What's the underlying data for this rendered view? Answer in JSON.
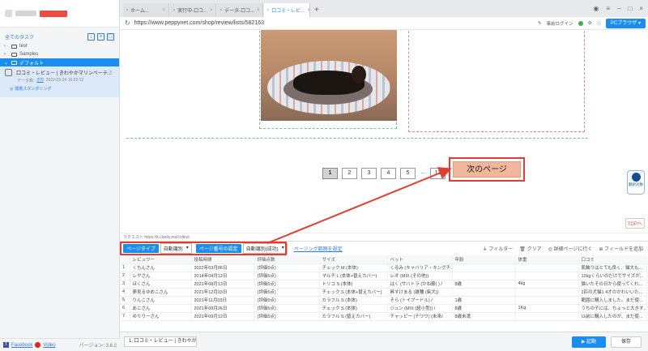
{
  "sidebar": {
    "all_tasks": "全てのタスク",
    "tree": [
      {
        "label": "test",
        "caret": "›"
      },
      {
        "label": "Samples",
        "caret": "›"
      },
      {
        "label": "デフォルト",
        "caret": "⌄"
      }
    ],
    "task": {
      "title": "口コミ・レビュー | きわやかマリンベーテ...",
      "meta_label": "データ数:",
      "meta_count": "270",
      "meta_time": "2022-03-24 16:52:12",
      "status": "閲覧スタンダリング",
      "close": "×"
    },
    "footer": {
      "facebook": "Facebook",
      "video": "Video",
      "version": "バージョン: 3.6.2"
    }
  },
  "tabs": [
    {
      "label": "ホーム..."
    },
    {
      "label": "実行中-口コ..."
    },
    {
      "label": "データ-口コ..."
    },
    {
      "label": "口コミ・レビ..."
    }
  ],
  "url": "https://www.peppynet.com/shop/review/lists/582163",
  "urlbar": {
    "login": "事前ログイン",
    "pc": "PCブラウザ"
  },
  "pager": {
    "pages": [
      "1",
      "2",
      "3",
      "4",
      "5",
      "12"
    ],
    "current": "1",
    "ellipsis": "...",
    "next": "次のページ"
  },
  "floaty": {
    "label": "翻訳対象"
  },
  "top_btn": "TOPへ",
  "request": "リクエスト:https://k.clarity.ms/collect",
  "data_toolbar": {
    "page_type": "ページタイプ",
    "page_type_value": "自動識別",
    "page_num": "ページ番号の認定",
    "page_num_value": "自動識別(成功)",
    "range": "ページング範囲を設定",
    "filter": "フィルター",
    "clear": "クリア",
    "detail": "詳細ページに行く",
    "add_field": "フィールドを追加"
  },
  "table": {
    "headers": [
      "",
      "レビュワー",
      "投稿時間",
      "評価点数",
      "サイズ",
      "ペット",
      "年齢",
      "体重",
      "口コミ"
    ],
    "rows": [
      [
        "1",
        "くちんさん",
        "2022年03月06日",
        "(評価5点)",
        "チェック M (本体)",
        "くるみ (キャバリア・キングチ...",
        "",
        "",
        "肌触りはとても良く、猫大も..."
      ],
      [
        "2",
        "レヤさん",
        "2014年04月12日",
        "(評価5点)",
        "マルチ L (本体+替えカバー)",
        "レオ (MIX (その他))",
        "",
        "",
        "12kgくらいのだけでサイズが..."
      ],
      [
        "3",
        "ほくさん",
        "2021年08月13日",
        "(評価5点)",
        "トリコ S (本体)",
        "はく (サバトラ (かね藤) )  /",
        "8歳",
        "4kg",
        "猫いたその日から使ってくれ..."
      ],
      [
        "4",
        "夢見るゆめこさん",
        "2021年12月03日",
        "(評価5点)",
        "チェック S (本体+替えカバー)",
        "昇すけまる (雑種 (柴犬))",
        "",
        "",
        "2匹の犬猫1 4才のかわいいた..."
      ],
      [
        "5",
        "りんこさん",
        "2021年11月03日",
        "(評価5点)",
        "カラフル S (本体)",
        "そら (トイプードル)  /",
        "1歳",
        "",
        "範囲に購入しました。まだ使..."
      ],
      [
        "6",
        "あこさん",
        "2021年09月26日",
        "(評価5点)",
        "チェック S (本体)",
        "ジュン (MIX (超小型)) /",
        "8歳",
        "1Kg",
        "うちの子には、ちょっと大きす..."
      ],
      [
        "7",
        "ゆりりーさん",
        "2021年09月12日",
        "(評価5点)",
        "カラフル S (替えカバー)",
        "チャッピー (チワワ) (未来/",
        "8歳未満",
        "",
        "以前に購入したのが、まだ使..."
      ]
    ]
  },
  "bottom": {
    "tab": "1. 口コミ・レビュー | きわやかマ...",
    "run": "▶ 起動",
    "save": "保存"
  },
  "colors": {
    "accent": "#1a8ef0",
    "highlight": "#e43d30"
  }
}
